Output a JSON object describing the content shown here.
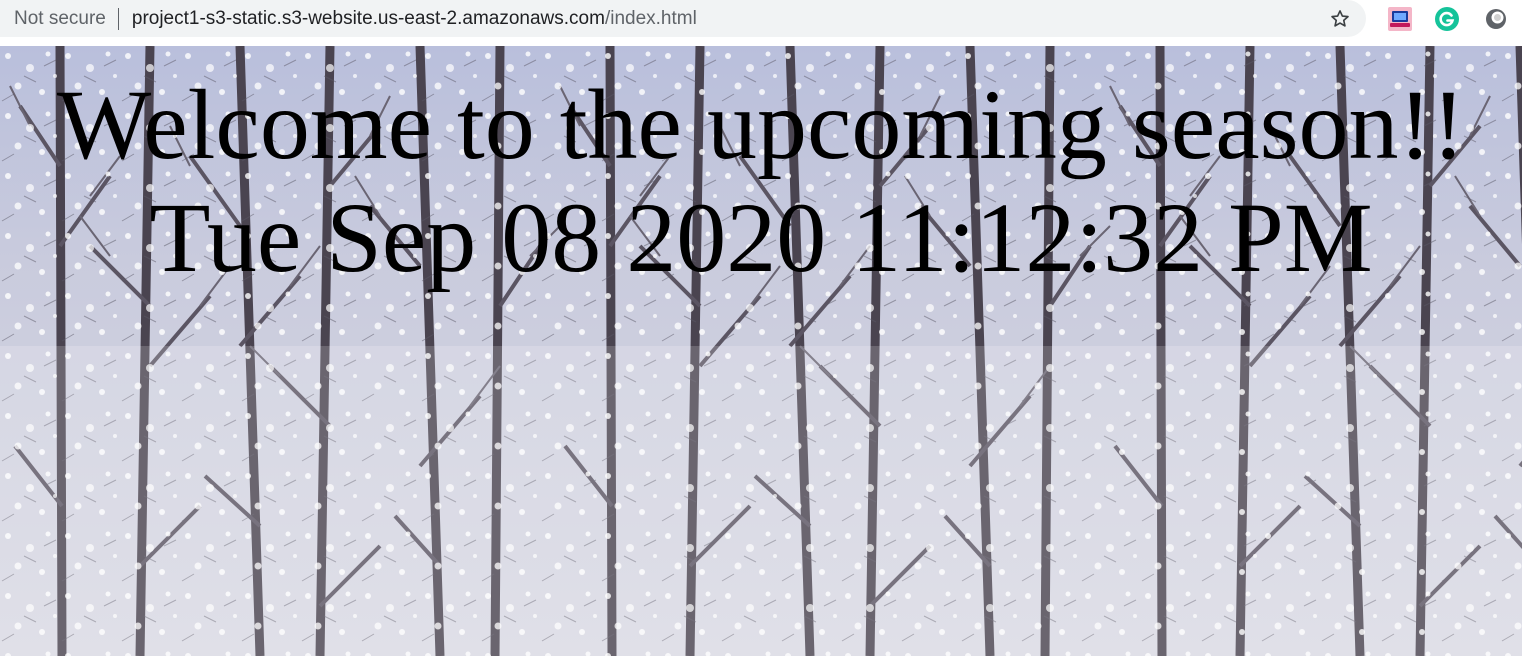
{
  "browser": {
    "security_label": "Not secure",
    "url_host": "project1-s3-static.s3-website.us-east-2.amazonaws.com",
    "url_path": "/index.html",
    "bookmark_icon": "star-outline-icon",
    "extensions": [
      {
        "icon": "laptop-extension-icon",
        "color": "#c2185b"
      },
      {
        "icon": "grammarly-extension-icon",
        "color": "#15c39a"
      },
      {
        "icon": "circle-extension-icon",
        "color": "#5f6368"
      }
    ]
  },
  "page": {
    "headline": "Welcome to the upcoming season!!",
    "datetime": "Tue Sep 08 2020 11:12:32 PM",
    "background": "snowy-forest-image"
  }
}
